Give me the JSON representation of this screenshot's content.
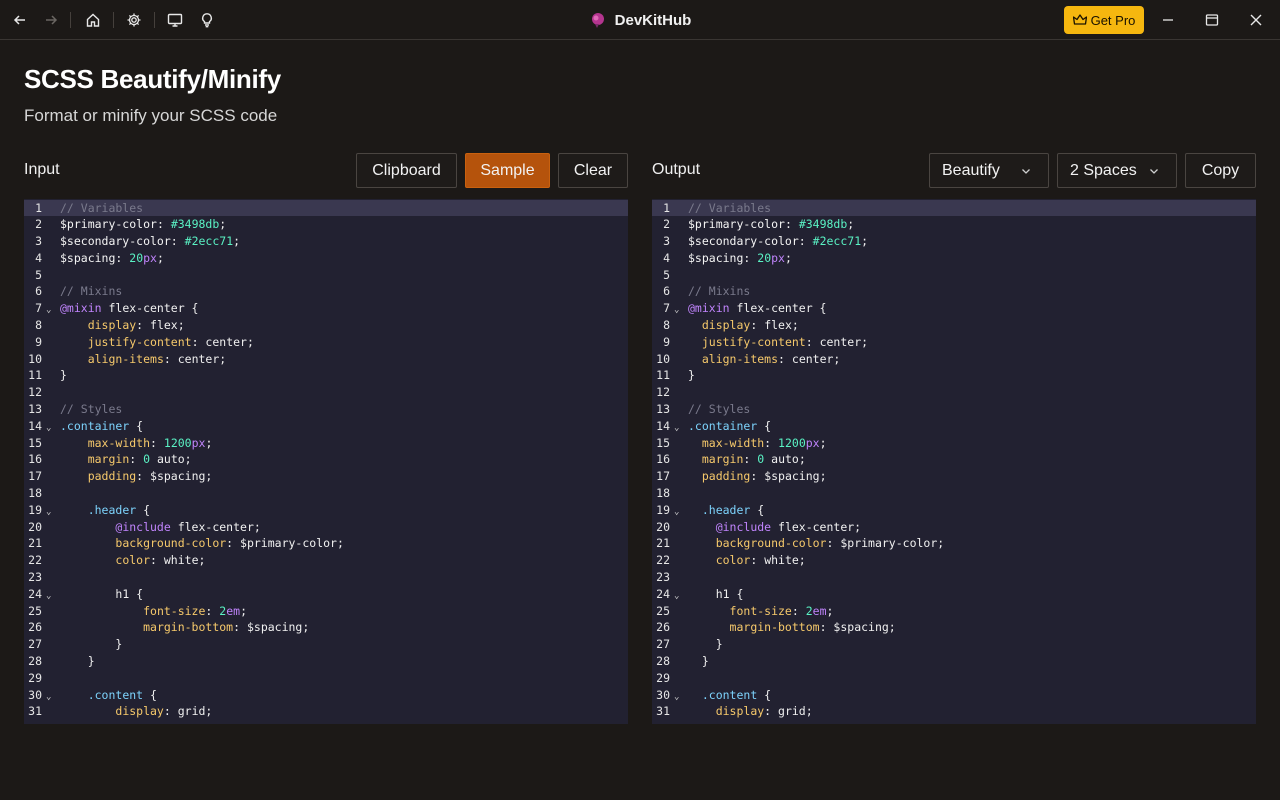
{
  "app": {
    "title": "DevKitHub",
    "get_pro_label": "Get Pro",
    "brand_color": "#f6b70f"
  },
  "nav_icons": [
    "back-arrow-icon",
    "forward-arrow-icon",
    "home-icon",
    "gear-icon",
    "monitor-icon",
    "lightbulb-icon"
  ],
  "window_icons": [
    "minimize-icon",
    "maximize-icon",
    "close-icon"
  ],
  "page": {
    "title": "SCSS Beautify/Minify",
    "subtitle": "Format or minify your SCSS code"
  },
  "input_panel": {
    "label": "Input",
    "clipboard_label": "Clipboard",
    "sample_label": "Sample",
    "clear_label": "Clear",
    "active_line": 1
  },
  "output_panel": {
    "label": "Output",
    "mode_value": "Beautify",
    "indent_value": "2 Spaces",
    "copy_label": "Copy",
    "active_line": 1
  },
  "input_lines": [
    "// Variables",
    "$primary-color: #3498db;",
    "$secondary-color: #2ecc71;",
    "$spacing: 20px;",
    "",
    "// Mixins",
    "@mixin flex-center {",
    "    display: flex;",
    "    justify-content: center;",
    "    align-items: center;",
    "}",
    "",
    "// Styles",
    ".container {",
    "    max-width: 1200px;",
    "    margin: 0 auto;",
    "    padding: $spacing;",
    "",
    "    .header {",
    "        @include flex-center;",
    "        background-color: $primary-color;",
    "        color: white;",
    "",
    "        h1 {",
    "            font-size: 2em;",
    "            margin-bottom: $spacing;",
    "        }",
    "    }",
    "",
    "    .content {",
    "        display: grid;"
  ],
  "output_lines": [
    "// Variables",
    "$primary-color: #3498db;",
    "$secondary-color: #2ecc71;",
    "$spacing: 20px;",
    "",
    "// Mixins",
    "@mixin flex-center {",
    "  display: flex;",
    "  justify-content: center;",
    "  align-items: center;",
    "}",
    "",
    "// Styles",
    ".container {",
    "  max-width: 1200px;",
    "  margin: 0 auto;",
    "  padding: $spacing;",
    "",
    "  .header {",
    "    @include flex-center;",
    "    background-color: $primary-color;",
    "    color: white;",
    "",
    "    h1 {",
    "      font-size: 2em;",
    "      margin-bottom: $spacing;",
    "    }",
    "  }",
    "",
    "  .content {",
    "    display: grid;"
  ],
  "fold_lines": [
    7,
    14,
    19,
    24,
    30
  ]
}
